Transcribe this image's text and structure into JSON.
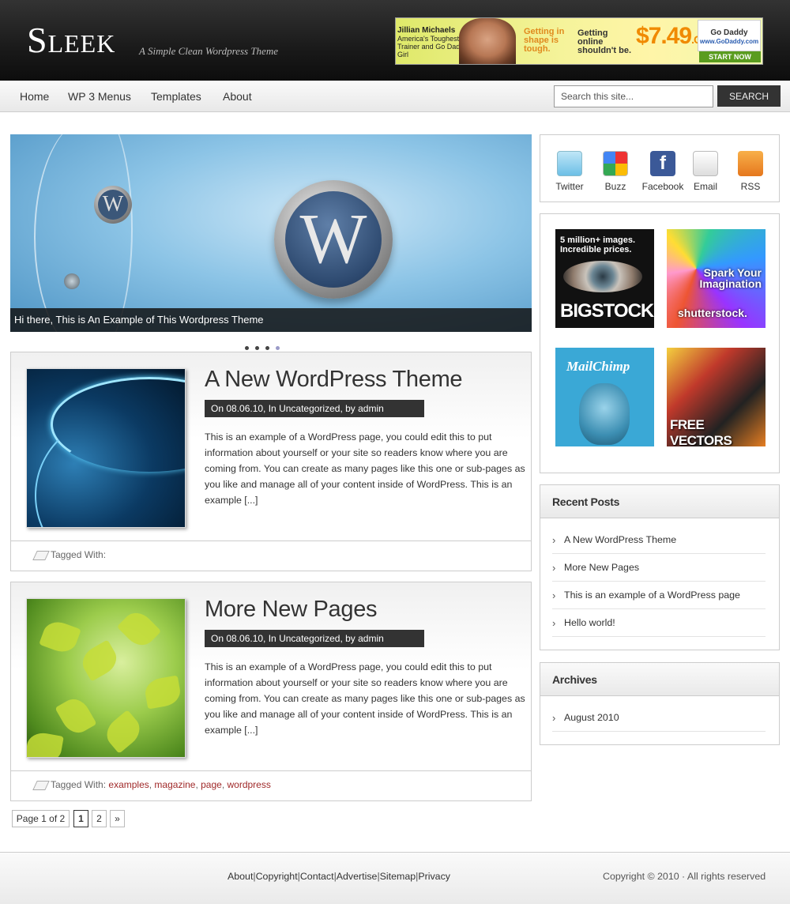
{
  "header": {
    "logo": "Sleek",
    "tagline": "A Simple Clean Wordpress Theme",
    "banner": {
      "line1": "Jillian Michaels",
      "line2": "America's Toughest Trainer and Go Daddy Girl",
      "slogan1": "Getting in shape is tough.",
      "slogan2": "Getting online shouldn't be.",
      "price": "$7.49",
      "price_suffix": ".COMS",
      "brand": "Go Daddy",
      "brand_url": "www.GoDaddy.com",
      "cta": "START NOW"
    }
  },
  "nav": {
    "items": [
      {
        "label": "Home"
      },
      {
        "label": "WP 3 Menus"
      },
      {
        "label": "Templates"
      },
      {
        "label": "About"
      }
    ],
    "search_placeholder": "Search this site...",
    "search_button": "SEARCH"
  },
  "slider": {
    "caption": "Hi there, This is An Example of This Wordpress Theme",
    "dots": 4,
    "active_dot": 4
  },
  "posts": [
    {
      "title": "A New WordPress Theme",
      "meta": "On 08.06.10, In Uncategorized, by admin",
      "excerpt": "This is an example of a WordPress page, you could edit this to put information about yourself or your site so readers know where you are coming from. You can create as many pages like this one or sub-pages as you like and manage all of your content inside of WordPress. This is an example [...]",
      "tagged_label": "Tagged With:",
      "tags": []
    },
    {
      "title": "More New Pages",
      "meta": "On 08.06.10, In Uncategorized, by admin",
      "excerpt": "This is an example of a WordPress page, you could edit this to put information about yourself or your site so readers know where you are coming from. You can create as many pages like this one or sub-pages as you like and manage all of your content inside of WordPress. This is an example [...]",
      "tagged_label": "Tagged With:",
      "tags": [
        "examples",
        "magazine",
        "page",
        "wordpress"
      ]
    }
  ],
  "pagination": {
    "label": "Page 1 of 2",
    "pages": [
      "1",
      "2"
    ],
    "current": "1",
    "next": "»"
  },
  "social": [
    {
      "label": "Twitter",
      "icon": "twitter-icon",
      "color": "#7ac8e8"
    },
    {
      "label": "Buzz",
      "icon": "buzz-icon",
      "color": "#e8e8e8"
    },
    {
      "label": "Facebook",
      "icon": "facebook-icon",
      "color": "#3b5998"
    },
    {
      "label": "Email",
      "icon": "email-icon",
      "color": "#f2f2f2"
    },
    {
      "label": "RSS",
      "icon": "rss-icon",
      "color": "#f29322"
    }
  ],
  "ads": [
    {
      "name": "bigstock",
      "label": "BIGSTOCK",
      "text": "5 million+ images. Incredible prices."
    },
    {
      "name": "shutterstock",
      "label": "shutterstock.",
      "text": "Spark Your Imagination"
    },
    {
      "name": "mailchimp",
      "label": "MailChimp",
      "text": ""
    },
    {
      "name": "freevectors",
      "label": "FREE VECTORS",
      "text": ""
    }
  ],
  "recent_posts": {
    "title": "Recent Posts",
    "items": [
      "A New WordPress Theme",
      "More New Pages",
      "This is an example of a WordPress page",
      "Hello world!"
    ]
  },
  "archives": {
    "title": "Archives",
    "items": [
      "August 2010"
    ]
  },
  "footer": {
    "links": [
      "About",
      "Copyright",
      "Contact",
      "Advertise",
      "Sitemap",
      "Privacy"
    ],
    "copyright": "Copyright © 2010 · All rights reserved"
  }
}
